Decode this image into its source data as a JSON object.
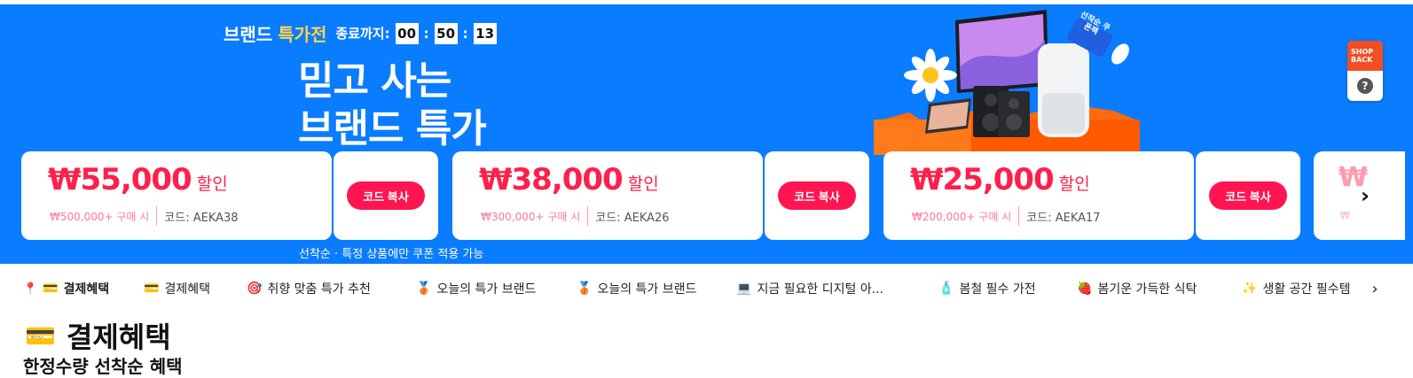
{
  "banner": {
    "brand_label": "브랜드",
    "brand_accent": "특가전",
    "ends_label": "종료까지:",
    "timer": {
      "hh": "00",
      "mm": "50",
      "ss": "13",
      "sep": ":"
    },
    "headline_line1": "믿고 사는",
    "headline_line2": "브랜드 특가",
    "hero_badge": "선착순 쿠폰팩",
    "note": "선착순 · 특정 상품에만 쿠폰 적용 가능",
    "bg_color": "#0a7cff",
    "accent_color": "#ff1650"
  },
  "coupons": [
    {
      "amount": "₩55,000",
      "unit": "할인",
      "min": "₩500,000+ 구매 시",
      "code": "코드: AEKA38",
      "copy_label": "코드 복사"
    },
    {
      "amount": "₩38,000",
      "unit": "할인",
      "min": "₩300,000+ 구매 시",
      "code": "코드: AEKA26",
      "copy_label": "코드 복사"
    },
    {
      "amount": "₩25,000",
      "unit": "할인",
      "min": "₩200,000+ 구매 시",
      "code": "코드: AEKA17",
      "copy_label": "코드 복사"
    },
    {
      "amount": "₩",
      "min": "₩"
    }
  ],
  "carousel_next": "›",
  "side_widget": {
    "brand": "SHOP BACK",
    "help": "?"
  },
  "tabs": [
    {
      "icon": "📍",
      "emoji": "💳",
      "label": "결제혜택",
      "active": true
    },
    {
      "emoji": "💳",
      "label": "결제혜택"
    },
    {
      "emoji": "🎯",
      "label": "취향 맞춤 특가 추천"
    },
    {
      "emoji": "🥉",
      "label": "오늘의 특가 브랜드"
    },
    {
      "emoji": "🥉",
      "label": "오늘의 특가 브랜드"
    },
    {
      "emoji": "💻",
      "label": "지금 필요한 디지털 아..."
    },
    {
      "emoji": "🧴",
      "label": "봄철 필수 가전"
    },
    {
      "emoji": "🍓",
      "label": "봄기운 가득한 식탁"
    },
    {
      "emoji": "✨",
      "label": "생활 공간 필수템"
    }
  ],
  "tabs_next": "›",
  "section": {
    "emoji": "💳",
    "title": "결제혜택",
    "subtitle": "한정수량 선착순 혜택"
  }
}
